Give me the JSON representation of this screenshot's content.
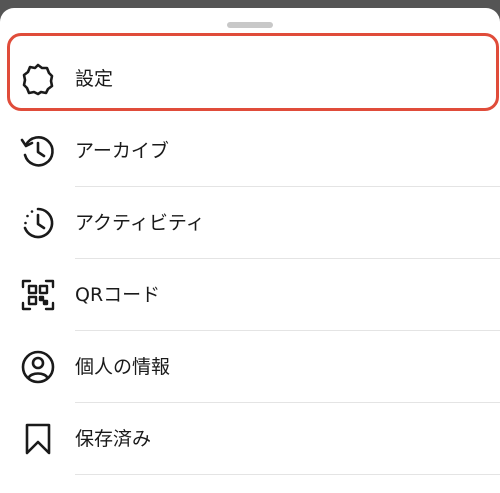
{
  "menu": {
    "items": [
      {
        "label": "設定",
        "icon": "gear-icon"
      },
      {
        "label": "アーカイブ",
        "icon": "archive-history-icon"
      },
      {
        "label": "アクティビティ",
        "icon": "activity-clock-icon"
      },
      {
        "label": "QRコード",
        "icon": "qr-code-icon"
      },
      {
        "label": "個人の情報",
        "icon": "person-icon"
      },
      {
        "label": "保存済み",
        "icon": "bookmark-icon"
      }
    ]
  },
  "colors": {
    "highlight": "#e04c3a",
    "text": "#1a1a1a",
    "divider": "#e4e4e4"
  }
}
